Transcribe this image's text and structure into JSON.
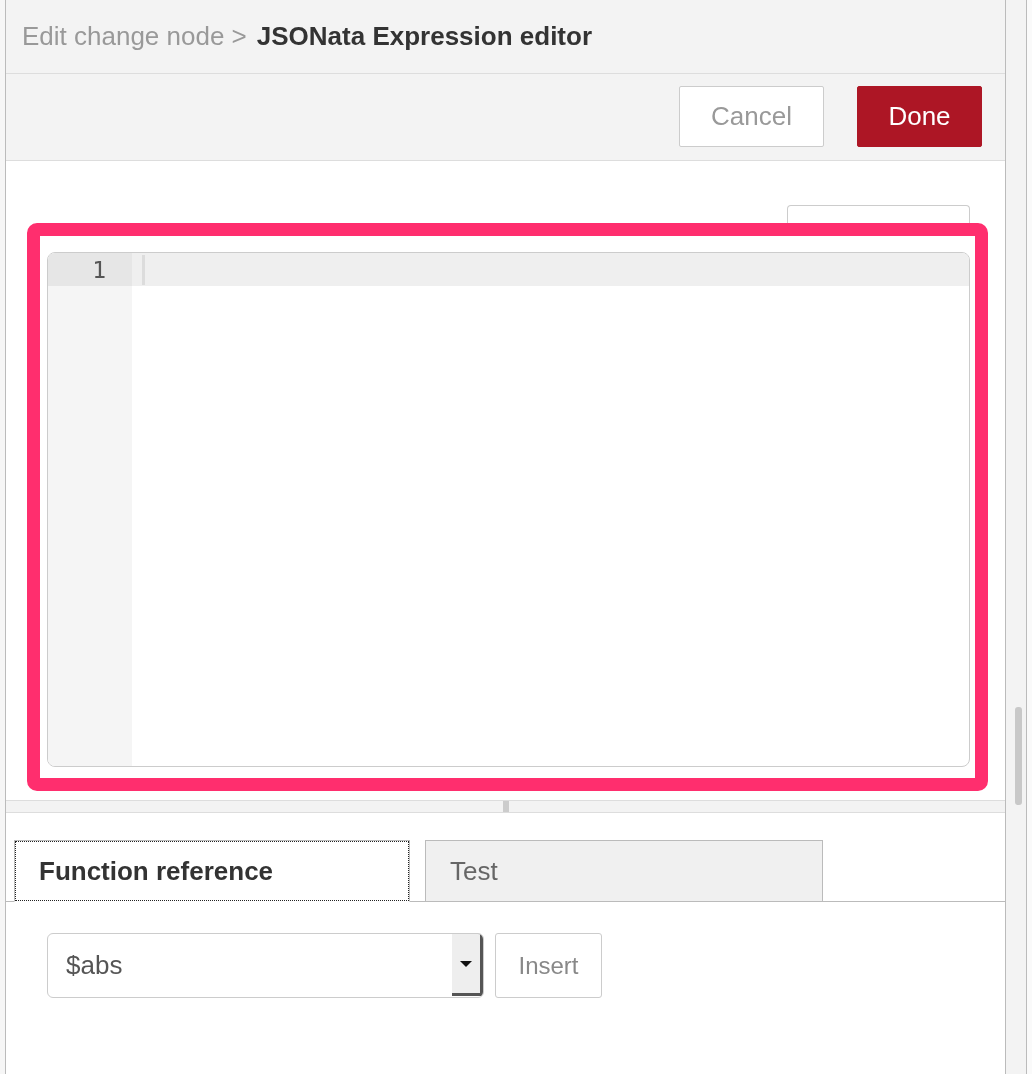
{
  "breadcrumb": {
    "trail": "Edit change node >",
    "title": "JSONata Expression editor"
  },
  "toolbar": {
    "buttons": [
      {
        "label": "Cancel",
        "kind": "secondary"
      },
      {
        "label": "Done",
        "kind": "primary"
      }
    ]
  },
  "editor": {
    "lines": [
      {
        "number": "1",
        "active": true
      }
    ]
  },
  "tabs": [
    {
      "label": "Function reference",
      "selected": true
    },
    {
      "label": "Test",
      "selected": false
    }
  ],
  "function_picker": {
    "value": "$abs",
    "insert_button": "Insert"
  }
}
